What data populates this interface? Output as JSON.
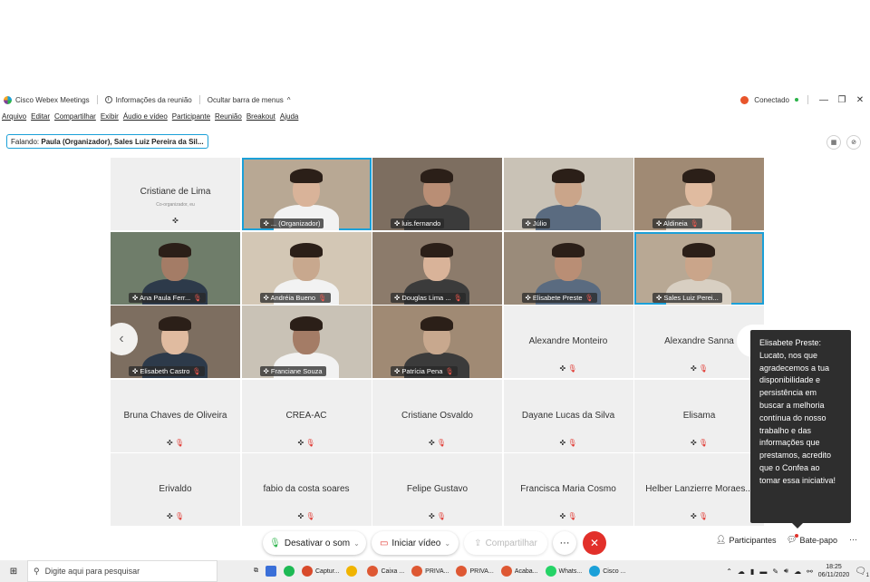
{
  "titlebar": {
    "app_name": "Cisco Webex Meetings",
    "info": "Informações da reunião",
    "hide_menu": "Ocultar barra de menus",
    "hide_menu_chevron": "^",
    "status": "Conectado",
    "minimize": "—",
    "restore": "❐",
    "close": "✕"
  },
  "menu": [
    "Arquivo",
    "Editar",
    "Compartilhar",
    "Exibir",
    "Áudio e vídeo",
    "Participante",
    "Reunião",
    "Breakout",
    "Ajuda"
  ],
  "speaking": {
    "label": "Falando:",
    "names": "Paula (Organizador), Sales Luiz Pereira da Sil..."
  },
  "tiles": [
    {
      "name": "Cristiane de Lima",
      "sub": "Co-organizador, eu",
      "video": false
    },
    {
      "name": "... (Organizador)",
      "video": true,
      "active": true,
      "muted": false
    },
    {
      "name": "luis.fernando",
      "video": true,
      "muted": false
    },
    {
      "name": "Júlio",
      "video": true,
      "muted": false
    },
    {
      "name": "Aldineia",
      "video": true,
      "muted": true
    },
    {
      "name": "Ana Paula Ferr...",
      "video": true,
      "muted": true
    },
    {
      "name": "Andréia Bueno",
      "video": true,
      "muted": true
    },
    {
      "name": "Douglas Lima ...",
      "video": true,
      "muted": true
    },
    {
      "name": "Elisabete Preste",
      "video": true,
      "muted": true
    },
    {
      "name": "Sales Luiz Perei...",
      "video": true,
      "active": true,
      "muted": false
    },
    {
      "name": "Elisabeth Castro",
      "video": true,
      "muted": true
    },
    {
      "name": "Franciane Souza",
      "video": true,
      "muted": false
    },
    {
      "name": "Patrícia Pena",
      "video": true,
      "muted": true
    },
    {
      "name": "Alexandre Monteiro",
      "video": false
    },
    {
      "name": "Alexandre Sanna",
      "video": false
    },
    {
      "name": "Bruna Chaves de Oliveira",
      "video": false
    },
    {
      "name": "CREA-AC",
      "video": false
    },
    {
      "name": "Cristiane Osvaldo",
      "video": false
    },
    {
      "name": "Dayane Lucas da Silva",
      "video": false
    },
    {
      "name": "Elisama",
      "video": false
    },
    {
      "name": "Erivaldo",
      "video": false
    },
    {
      "name": "fabio da costa soares",
      "video": false
    },
    {
      "name": "Felipe Gustavo",
      "video": false
    },
    {
      "name": "Francisca Maria Cosmo",
      "video": false
    },
    {
      "name": "Helber Lanzierre Moraes...",
      "video": false
    }
  ],
  "tooltip": {
    "text": "Elisabete Preste: Lucato, nos que agradecemos a tua disponibilidade e persistência em buscar a melhoria contínua do nosso trabalho e das informações que prestamos, acredito que o Confea ao tomar essa iniciativa!"
  },
  "controls": {
    "mute": "Desativar o som",
    "video": "Iniciar vídeo",
    "share": "Compartilhar",
    "more": "···",
    "end": "✕",
    "participants": "Participantes",
    "chat": "Bate-papo",
    "more_right": "···"
  },
  "taskbar": {
    "search_placeholder": "Digite aqui para pesquisar",
    "items": [
      {
        "label": "Captur...",
        "color": "#d84a2b"
      },
      {
        "label": "",
        "color": "#f0b400"
      },
      {
        "label": "Caixa ...",
        "color": "#de5833"
      },
      {
        "label": "PRIVA...",
        "color": "#de5833"
      },
      {
        "label": "PRIVA...",
        "color": "#de5833"
      },
      {
        "label": "Acaba...",
        "color": "#de5833"
      },
      {
        "label": "Whats...",
        "color": "#25d366"
      },
      {
        "label": "Cisco ...",
        "color": "#1ba0d8"
      }
    ],
    "time": "18:25",
    "date": "06/11/2020",
    "notification_count": "1"
  },
  "colors": {
    "accent": "#1ba0d8",
    "end_call": "#e2302a",
    "muted_mic": "#e0322b",
    "tooltip_bg": "#2e2e2e"
  }
}
